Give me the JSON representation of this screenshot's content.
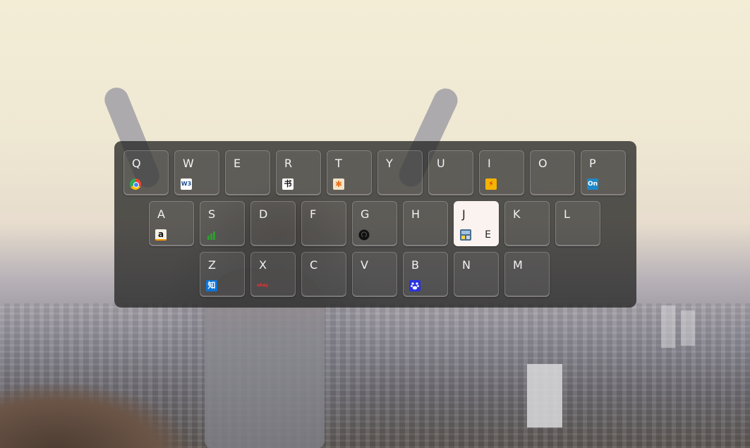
{
  "keyboard": {
    "rows": [
      [
        {
          "letter": "Q",
          "icon": "chrome-icon"
        },
        {
          "letter": "W",
          "icon": "w3schools-icon",
          "icon_text": "W3"
        },
        {
          "letter": "E",
          "icon": null
        },
        {
          "letter": "R",
          "icon": "calligraphy-icon",
          "icon_text": "书"
        },
        {
          "letter": "T",
          "icon": "asterisk-icon",
          "icon_text": "✱"
        },
        {
          "letter": "Y",
          "icon": null
        },
        {
          "letter": "U",
          "icon": null
        },
        {
          "letter": "I",
          "icon": "flash-icon",
          "icon_text": "⚡"
        },
        {
          "letter": "O",
          "icon": null
        },
        {
          "letter": "P",
          "icon": "on-icon",
          "icon_text": "On"
        }
      ],
      [
        {
          "letter": "A",
          "icon": "amazon-icon",
          "icon_text": "a"
        },
        {
          "letter": "S",
          "icon": "signal-bars-icon"
        },
        {
          "letter": "D",
          "icon": null
        },
        {
          "letter": "F",
          "icon": null
        },
        {
          "letter": "G",
          "icon": "github-icon"
        },
        {
          "letter": "H",
          "icon": null
        },
        {
          "letter": "J",
          "icon": "app-icon",
          "sub": "E",
          "active": true
        },
        {
          "letter": "K",
          "icon": null
        },
        {
          "letter": "L",
          "icon": null
        }
      ],
      [
        {
          "letter": "Z",
          "icon": "zhihu-icon",
          "icon_text": "知"
        },
        {
          "letter": "X",
          "icon": "ebay-icon",
          "icon_text": "ebay"
        },
        {
          "letter": "C",
          "icon": null
        },
        {
          "letter": "V",
          "icon": null
        },
        {
          "letter": "B",
          "icon": "baidu-paw-icon"
        },
        {
          "letter": "N",
          "icon": null
        },
        {
          "letter": "M",
          "icon": null
        }
      ]
    ]
  }
}
